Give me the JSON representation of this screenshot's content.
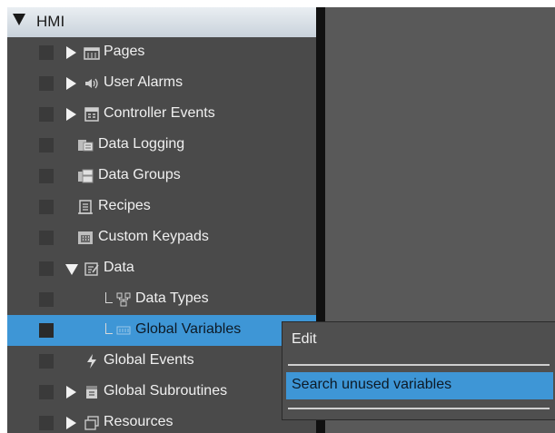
{
  "tree": {
    "root_label": "HMI",
    "items": [
      {
        "label": "Pages",
        "icon": "pages-icon"
      },
      {
        "label": "User Alarms",
        "icon": "speaker-icon"
      },
      {
        "label": "Controller Events",
        "icon": "controller-events-icon"
      },
      {
        "label": "Data Logging",
        "icon": "data-logging-icon"
      },
      {
        "label": "Data Groups",
        "icon": "data-groups-icon"
      },
      {
        "label": "Recipes",
        "icon": "recipes-icon"
      },
      {
        "label": "Custom Keypads",
        "icon": "keypad-icon"
      },
      {
        "label": "Data",
        "icon": "data-icon"
      },
      {
        "label": "Data Types",
        "icon": "data-types-icon"
      },
      {
        "label": "Global Variables",
        "icon": "global-variables-icon",
        "selected": true
      },
      {
        "label": "Global Events",
        "icon": "lightning-icon"
      },
      {
        "label": "Global Subroutines",
        "icon": "subroutines-icon"
      },
      {
        "label": "Resources",
        "icon": "resources-icon"
      }
    ]
  },
  "context_menu": {
    "items": [
      "Edit",
      "Search unused variables"
    ],
    "highlighted": "Search unused variables"
  },
  "colors": {
    "selection": "#3e96d6",
    "tree_background": "#4a4a4a",
    "main_background": "#595959"
  }
}
